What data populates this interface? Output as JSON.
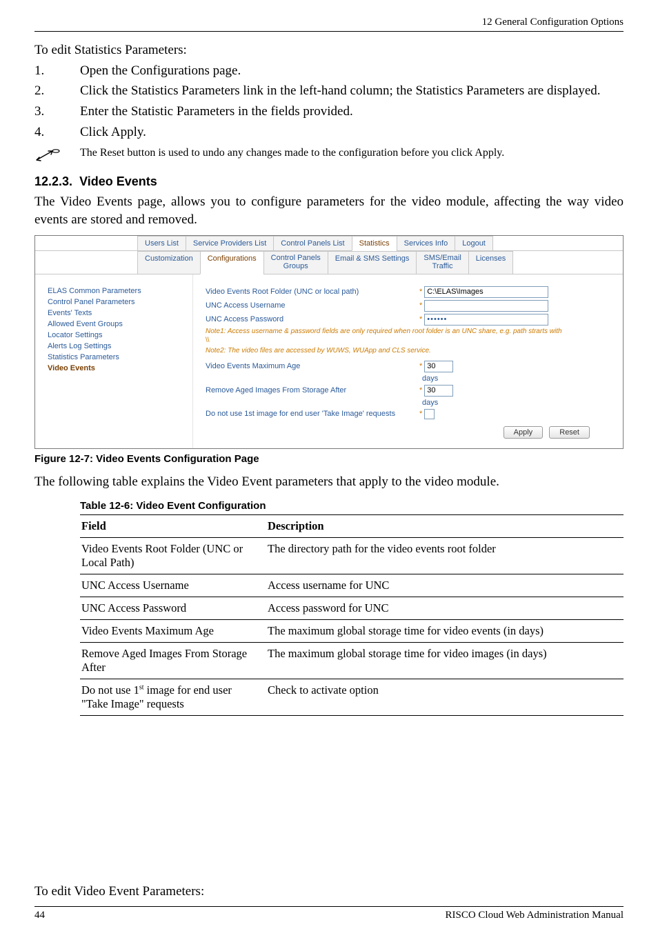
{
  "header": {
    "chapter": "12 General Configuration Options"
  },
  "intro": "To edit Statistics Parameters:",
  "steps": [
    {
      "n": "1.",
      "t": "Open the Configurations page."
    },
    {
      "n": "2.",
      "t": "Click the Statistics Parameters link in the left-hand column; the Statistics Parameters are displayed."
    },
    {
      "n": "3.",
      "t": "Enter the Statistic Parameters in the fields provided."
    },
    {
      "n": "4.",
      "t": "Click Apply."
    }
  ],
  "note": "The Reset button is used to undo any changes made to the configuration before you click Apply.",
  "section": {
    "num": "12.2.3.",
    "title": "Video Events"
  },
  "section_intro": "The Video Events page, allows you to configure parameters for the video module, affecting the way video events are stored and removed.",
  "tabs_row1": [
    "Users List",
    "Service Providers List",
    "Control Panels List",
    "Statistics",
    "Services Info",
    "Logout"
  ],
  "tabs_row2": [
    "Customization",
    "Configurations",
    "Control Panels Groups",
    "Email & SMS Settings",
    "SMS/Email Traffic",
    "Licenses"
  ],
  "tabs_row1_active_index": 3,
  "tabs_row2_active_index": 1,
  "sidebar_items": [
    "ELAS Common Parameters",
    "Control Panel Parameters",
    "Events' Texts",
    "Allowed Event Groups",
    "Locator Settings",
    "Alerts Log Settings",
    "Statistics Parameters",
    "Video Events"
  ],
  "sidebar_current_index": 7,
  "form": {
    "root_folder_label": "Video Events Root Folder (UNC or local path)",
    "root_folder_value": "C:\\ELAS\\Images",
    "username_label": "UNC Access Username",
    "username_value": "",
    "password_label": "UNC Access Password",
    "password_value": "••••••",
    "note1": "Note1:  Access username & password fields are only required when root folder is an UNC share, e.g. path strarts with",
    "note1_line2": "\\\\",
    "note2": "Note2:  The video files are accessed by WUWS, WUApp and CLS service.",
    "max_age_label": "Video Events Maximum Age",
    "max_age_value": "30",
    "remove_after_label": "Remove Aged Images From Storage After",
    "remove_after_value": "30",
    "days": "days",
    "no1st_label": "Do not use 1st image for end user 'Take Image' requests",
    "apply": "Apply",
    "reset": "Reset"
  },
  "fig_caption": "Figure 12-7: Video Events Configuration Page",
  "table_lead": "The following table explains the Video Event parameters that apply to the video module.",
  "table_title": "Table 12-6: Video Event Configuration",
  "table": {
    "head": [
      "Field",
      "Description"
    ],
    "rows": [
      [
        "Video Events Root Folder (UNC or Local Path)",
        "The directory path for the video events root folder"
      ],
      [
        "UNC Access Username",
        "Access username for UNC"
      ],
      [
        "UNC Access Password",
        "Access password for UNC"
      ],
      [
        "Video Events Maximum Age",
        "The maximum global storage time for video events (in days)"
      ],
      [
        "Remove Aged Images From Storage After",
        "The maximum global storage time for video images (in days)"
      ],
      [
        "Do not use 1st image for end user \"Take Image\" requests",
        "Check to activate option"
      ]
    ],
    "sup_row_index": 5
  },
  "outro": "To edit Video Event Parameters:",
  "footer": {
    "page": "44",
    "doc": "RISCO Cloud Web Administration Manual"
  }
}
